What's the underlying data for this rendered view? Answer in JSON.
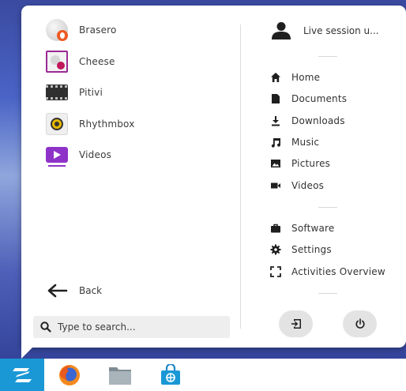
{
  "apps": [
    {
      "label": "Brasero",
      "icon": "brasero-icon"
    },
    {
      "label": "Cheese",
      "icon": "cheese-icon"
    },
    {
      "label": "Pitivi",
      "icon": "pitivi-icon"
    },
    {
      "label": "Rhythmbox",
      "icon": "rhythmbox-icon"
    },
    {
      "label": "Videos",
      "icon": "videos-icon"
    }
  ],
  "back_label": "Back",
  "search": {
    "placeholder": "Type to search..."
  },
  "user": {
    "label": "Live session u..."
  },
  "places": [
    {
      "label": "Home",
      "icon": "home-icon"
    },
    {
      "label": "Documents",
      "icon": "document-icon"
    },
    {
      "label": "Downloads",
      "icon": "download-icon"
    },
    {
      "label": "Music",
      "icon": "music-note-icon"
    },
    {
      "label": "Pictures",
      "icon": "picture-icon"
    },
    {
      "label": "Videos",
      "icon": "video-camera-icon"
    }
  ],
  "system": [
    {
      "label": "Software",
      "icon": "briefcase-icon"
    },
    {
      "label": "Settings",
      "icon": "gear-icon"
    },
    {
      "label": "Activities Overview",
      "icon": "fullscreen-corners-icon"
    }
  ],
  "colors": {
    "accent": "#1a98d6",
    "panel": "#ffffff",
    "videos": "#8e33c7",
    "brasero": "#ee5a24"
  }
}
